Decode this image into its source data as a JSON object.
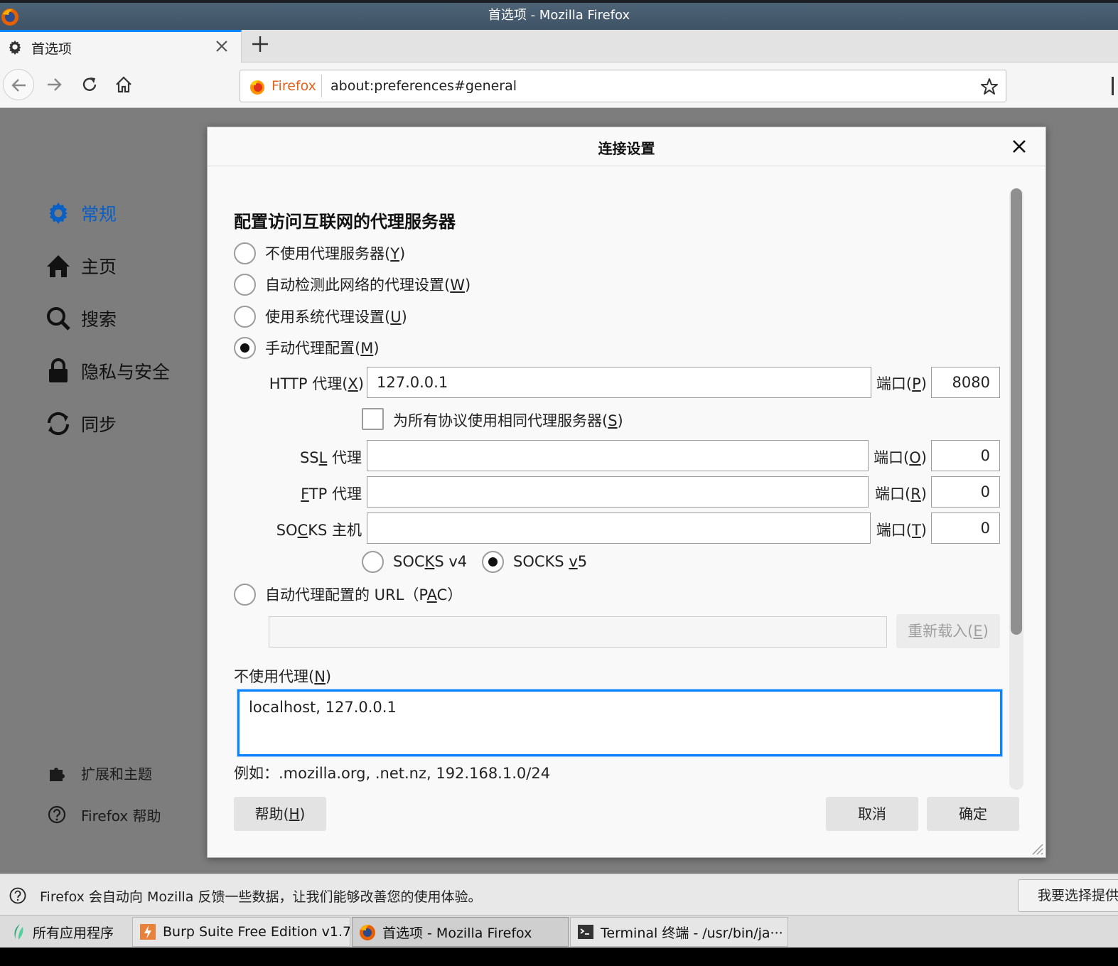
{
  "window": {
    "title": "首选项 - Mozilla Firefox"
  },
  "tab": {
    "title": "首选项"
  },
  "urlbar": {
    "identity": "Firefox",
    "url": "about:preferences#general"
  },
  "sidebar": {
    "items": [
      {
        "label": "常规",
        "icon": "gear-icon"
      },
      {
        "label": "主页",
        "icon": "home-icon"
      },
      {
        "label": "搜索",
        "icon": "search-icon"
      },
      {
        "label": "隐私与安全",
        "icon": "lock-icon"
      },
      {
        "label": "同步",
        "icon": "sync-icon"
      }
    ],
    "footer": [
      {
        "label": "扩展和主题",
        "icon": "puzzle-icon"
      },
      {
        "label": "Firefox 帮助",
        "icon": "help-icon"
      }
    ]
  },
  "dialog": {
    "title": "连接设置",
    "heading": "配置访问互联网的代理服务器",
    "options": {
      "no_proxy": {
        "label": "不使用代理服务器(",
        "key": "Y",
        "end": ")"
      },
      "auto_detect": {
        "label": "自动检测此网络的代理设置(",
        "key": "W",
        "end": ")"
      },
      "system": {
        "label": "使用系统代理设置(",
        "key": "U",
        "end": ")"
      },
      "manual": {
        "label": "手动代理配置(",
        "key": "M",
        "end": ")"
      },
      "pac": {
        "label": "自动代理配置的 URL（P",
        "key": "A",
        "end": "C）"
      }
    },
    "http": {
      "label": "HTTP 代理(",
      "key": "X",
      "end": ")",
      "value": "127.0.0.1",
      "port_label": "端口(",
      "port_key": "P",
      "port_end": ")",
      "port": "8080"
    },
    "same_proxy": {
      "label": "为所有协议使用相同代理服务器(",
      "key": "S",
      "end": ")"
    },
    "ssl": {
      "pre": "SS",
      "key": "L",
      "end": " 代理",
      "value": "",
      "port_label": "端口(",
      "port_key": "O",
      "port_end": ")",
      "port": "0"
    },
    "ftp": {
      "pre": "",
      "key": "F",
      "end": "TP 代理",
      "value": "",
      "port_label": "端口(",
      "port_key": "R",
      "port_end": ")",
      "port": "0"
    },
    "socks": {
      "pre": "SO",
      "key": "C",
      "end": "KS 主机",
      "value": "",
      "port_label": "端口(",
      "port_key": "T",
      "port_end": ")",
      "port": "0"
    },
    "socks_v4": {
      "pre": "SOC",
      "key": "K",
      "end": "S v4"
    },
    "socks_v5": {
      "pre": "SOCKS ",
      "key": "v",
      "end": "5"
    },
    "pac_url": "",
    "reload": {
      "label": "重新载入(",
      "key": "E",
      "end": ")"
    },
    "no_proxy_for": {
      "label": "不使用代理(",
      "key": "N",
      "end": ")",
      "value": "localhost, 127.0.0.1"
    },
    "example": "例如：.mozilla.org, .net.nz, 192.168.1.0/24",
    "help": {
      "label": "帮助(",
      "key": "H",
      "end": ")"
    },
    "cancel": "取消",
    "ok": "确定"
  },
  "notification": {
    "message": "Firefox 会自动向 Mozilla 反馈一些数据，让我们能够改善您的使用体验。",
    "button": "我要选择提供"
  },
  "taskbar": {
    "items": [
      {
        "label": "所有应用程序"
      },
      {
        "label": "Burp Suite Free Edition v1.7···"
      },
      {
        "label": "首选项 - Mozilla Firefox"
      },
      {
        "label": "Terminal 终端 - /usr/bin/ja···"
      }
    ]
  },
  "colors": {
    "accent": "#0a84ff",
    "sidebar_active": "#0a5fc5",
    "firefox_orange": "#e2621b"
  }
}
